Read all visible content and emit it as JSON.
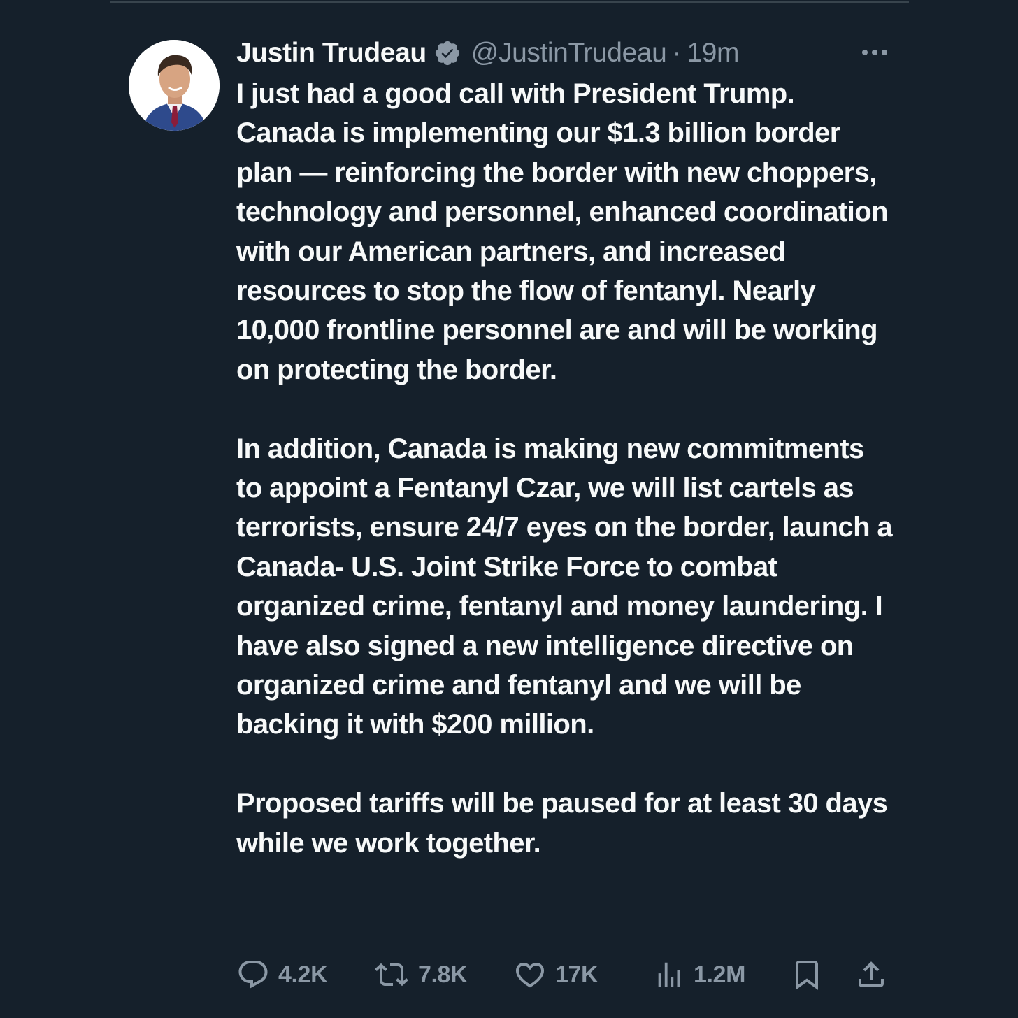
{
  "tweet": {
    "author": {
      "name": "Justin Trudeau",
      "handle": "@JustinTrudeau",
      "verified": true
    },
    "separator": "·",
    "timestamp": "19m",
    "paragraphs": [
      "I just had a good call with President Trump. Canada is implementing our $1.3 billion border plan — reinforcing the border with new choppers, technology and personnel, enhanced coordination with our American partners, and increased resources to stop the flow of fentanyl. Nearly 10,000 frontline personnel are and will be working on protecting the border.",
      "In addition, Canada is making new commitments to appoint a Fentanyl Czar, we will list cartels as terrorists, ensure 24/7 eyes on the border, launch a Canada- U.S. Joint Strike Force to combat organized crime, fentanyl and money laundering. I have also signed a new intelligence directive on organized crime and fentanyl and we will be backing it with $200 million.",
      "Proposed tariffs will be paused for at least 30 days while we work together."
    ],
    "metrics": {
      "replies": "4.2K",
      "retweets": "7.8K",
      "likes": "17K",
      "views": "1.2M"
    }
  },
  "icons": {
    "verified": "verified-badge-icon",
    "more": "more-horizontal-icon",
    "reply": "reply-icon",
    "retweet": "retweet-icon",
    "like": "heart-icon",
    "views": "views-icon",
    "bookmark": "bookmark-icon",
    "share": "share-icon"
  },
  "colors": {
    "background": "#15202b",
    "text_primary": "#f7f9f9",
    "text_secondary": "#8b98a5",
    "verified_badge": "#8b98a5",
    "divider": "#38444d"
  }
}
